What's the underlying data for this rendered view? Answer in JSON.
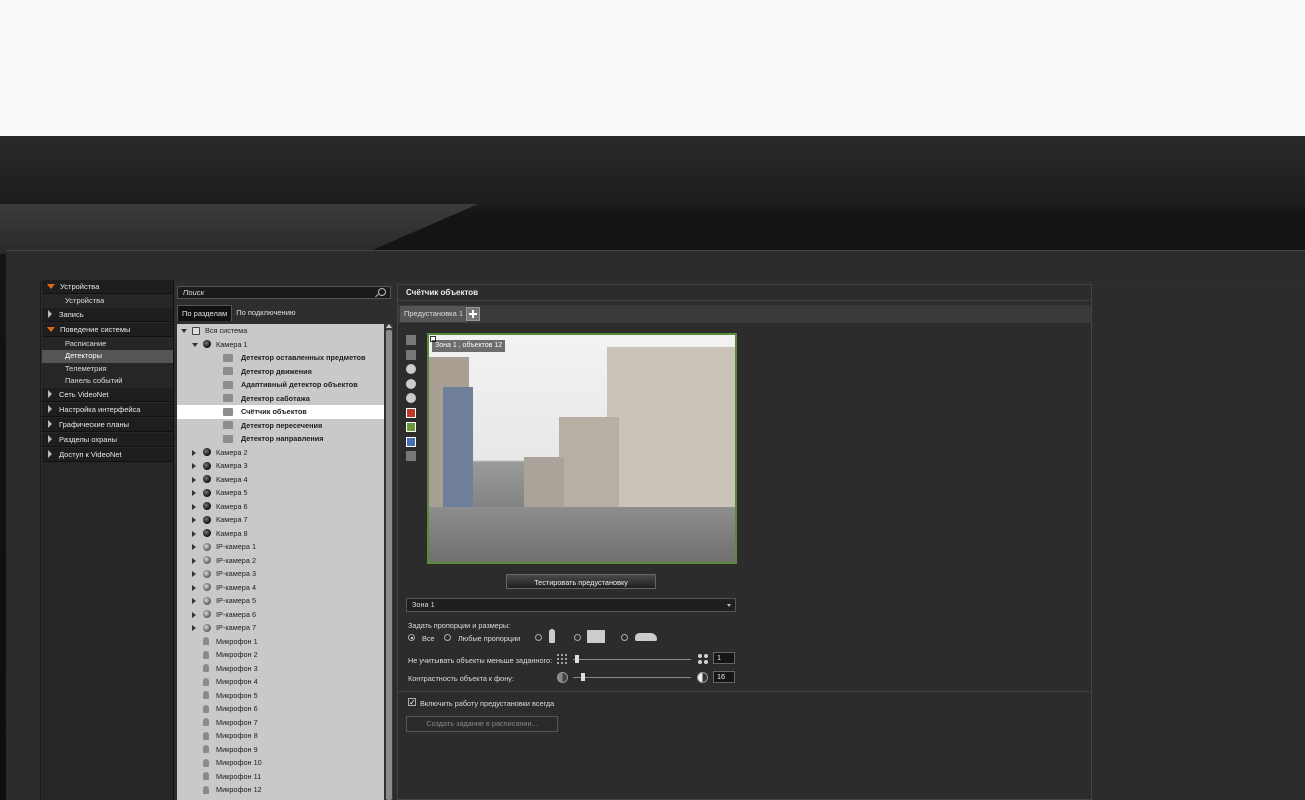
{
  "nav": {
    "groups": [
      {
        "label": "Устройства",
        "open": true,
        "items": [
          "Устройства"
        ]
      },
      {
        "label": "Запись",
        "open": false,
        "items": []
      },
      {
        "label": "Поведение системы",
        "open": true,
        "items": [
          "Расписание",
          "Детекторы",
          "Телеметрия",
          "Панель событий"
        ],
        "selected": "Детекторы"
      },
      {
        "label": "Сеть VideoNet",
        "open": false,
        "items": []
      },
      {
        "label": "Настройка интерфейса",
        "open": false,
        "items": []
      },
      {
        "label": "Графические планы",
        "open": false,
        "items": []
      },
      {
        "label": "Разделы охраны",
        "open": false,
        "items": []
      },
      {
        "label": "Доступ к VideoNet",
        "open": false,
        "items": []
      }
    ]
  },
  "search": {
    "placeholder": "Поиск"
  },
  "tabs": [
    "По разделам",
    "По подключению"
  ],
  "tree": [
    {
      "label": "Вся система",
      "level": 0,
      "icon": "system-icon",
      "arrow": "down"
    },
    {
      "label": "Камера 1",
      "level": 1,
      "icon": "camera-icon",
      "arrow": "down"
    },
    {
      "label": "Детектор оставленных предметов",
      "level": 2,
      "icon": "abandoned-object-icon",
      "bold": true
    },
    {
      "label": "Детектор движения",
      "level": 2,
      "icon": "motion-icon",
      "bold": true
    },
    {
      "label": "Адаптивный детектор объектов",
      "level": 2,
      "icon": "adaptive-icon",
      "bold": true
    },
    {
      "label": "Детектор саботажа",
      "level": 2,
      "icon": "sabotage-icon",
      "bold": true
    },
    {
      "label": "Счётчик объектов",
      "level": 2,
      "icon": "counter-icon",
      "bold": true,
      "selected": true
    },
    {
      "label": "Детектор пересечения",
      "level": 2,
      "icon": "crossing-icon",
      "bold": true
    },
    {
      "label": "Детектор направления",
      "level": 2,
      "icon": "direction-icon",
      "bold": true
    },
    {
      "label": "Камера 2",
      "level": 1,
      "icon": "camera-icon",
      "arrow": "right"
    },
    {
      "label": "Камера 3",
      "level": 1,
      "icon": "camera-icon",
      "arrow": "right"
    },
    {
      "label": "Камера 4",
      "level": 1,
      "icon": "camera-icon",
      "arrow": "right"
    },
    {
      "label": "Камера 5",
      "level": 1,
      "icon": "camera-icon",
      "arrow": "right"
    },
    {
      "label": "Камера 6",
      "level": 1,
      "icon": "camera-icon",
      "arrow": "right"
    },
    {
      "label": "Камера 7",
      "level": 1,
      "icon": "camera-icon",
      "arrow": "right"
    },
    {
      "label": "Камера 8",
      "level": 1,
      "icon": "camera-icon",
      "arrow": "right"
    },
    {
      "label": "IP-камера 1",
      "level": 1,
      "icon": "ip-camera-icon",
      "arrow": "right"
    },
    {
      "label": "IP-камера 2",
      "level": 1,
      "icon": "ip-camera-icon",
      "arrow": "right"
    },
    {
      "label": "IP-камера 3",
      "level": 1,
      "icon": "ip-camera-icon",
      "arrow": "right"
    },
    {
      "label": "IP-камера 4",
      "level": 1,
      "icon": "ip-camera-icon",
      "arrow": "right"
    },
    {
      "label": "IP-камера 5",
      "level": 1,
      "icon": "ip-camera-icon",
      "arrow": "right"
    },
    {
      "label": "IP-камера 6",
      "level": 1,
      "icon": "ip-camera-icon",
      "arrow": "right"
    },
    {
      "label": "IP-камера 7",
      "level": 1,
      "icon": "ip-camera-icon",
      "arrow": "right"
    },
    {
      "label": "Микрофон 1",
      "level": 1,
      "icon": "microphone-icon"
    },
    {
      "label": "Микрофон 2",
      "level": 1,
      "icon": "microphone-icon"
    },
    {
      "label": "Микрофон 3",
      "level": 1,
      "icon": "microphone-icon"
    },
    {
      "label": "Микрофон 4",
      "level": 1,
      "icon": "microphone-icon"
    },
    {
      "label": "Микрофон 5",
      "level": 1,
      "icon": "microphone-icon"
    },
    {
      "label": "Микрофон 6",
      "level": 1,
      "icon": "microphone-icon"
    },
    {
      "label": "Микрофон 7",
      "level": 1,
      "icon": "microphone-icon"
    },
    {
      "label": "Микрофон 8",
      "level": 1,
      "icon": "microphone-icon"
    },
    {
      "label": "Микрофон 9",
      "level": 1,
      "icon": "microphone-icon"
    },
    {
      "label": "Микрофон 10",
      "level": 1,
      "icon": "microphone-icon"
    },
    {
      "label": "Микрофон 11",
      "level": 1,
      "icon": "microphone-icon"
    },
    {
      "label": "Микрофон 12",
      "level": 1,
      "icon": "microphone-icon"
    }
  ],
  "main": {
    "title": "Счётчик объектов",
    "preset_tab": "Предустановка 1",
    "zone_label": "Зона 1 , объектов 12",
    "test_button": "Тестировать предустановку",
    "zone_select": "Зона 1",
    "proportions_label": "Задать пропорции и размеры:",
    "radio_all": "Все",
    "radio_any": "Любые пропорции",
    "min_size_label": "Не учитывать объекты меньше заданного:",
    "min_size_value": "1",
    "contrast_label": "Контрастность объекта к фону:",
    "contrast_value": "16",
    "always_checkbox": "Включить работу предустановки всегда",
    "schedule_button": "Создать задание в расписании..."
  },
  "colors": {
    "accent": "#e2661c",
    "zone_border": "#5c8a3a"
  }
}
